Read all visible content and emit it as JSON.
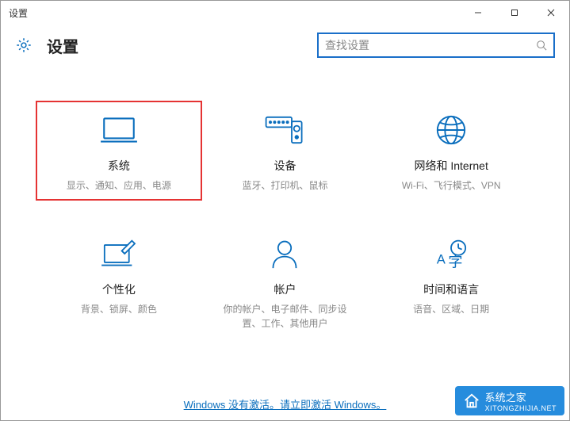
{
  "window": {
    "title": "设置"
  },
  "header": {
    "title": "设置"
  },
  "search": {
    "placeholder": "查找设置"
  },
  "tiles": {
    "system": {
      "title": "系统",
      "desc": "显示、通知、应用、电源"
    },
    "devices": {
      "title": "设备",
      "desc": "蓝牙、打印机、鼠标"
    },
    "network": {
      "title": "网络和 Internet",
      "desc": "Wi-Fi、飞行模式、VPN"
    },
    "personalize": {
      "title": "个性化",
      "desc": "背景、锁屏、颜色"
    },
    "accounts": {
      "title": "帐户",
      "desc": "你的帐户、电子邮件、同步设置、工作、其他用户"
    },
    "timelang": {
      "title": "时间和语言",
      "desc": "语音、区域、日期"
    }
  },
  "activation": {
    "text": "Windows 没有激活。请立即激活 Windows。"
  },
  "watermark": {
    "brand": "系统之家",
    "url": "XITONGZHIJIA.NET"
  },
  "colors": {
    "accent": "#0a6ebd",
    "highlight": "#e53333"
  }
}
